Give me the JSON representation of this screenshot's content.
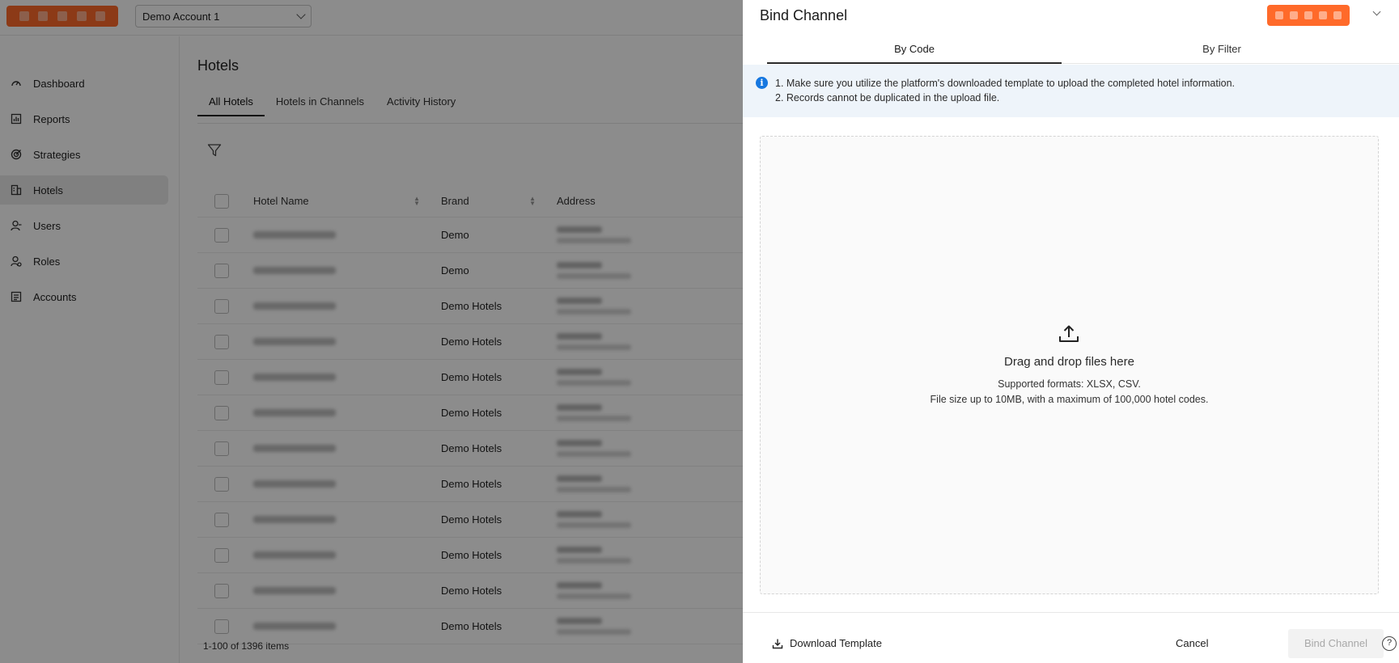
{
  "topbar": {
    "account": "Demo Account 1"
  },
  "sidebar": {
    "items": [
      {
        "label": "Dashboard",
        "icon": "dashboard-icon",
        "active": false
      },
      {
        "label": "Reports",
        "icon": "reports-icon",
        "active": false
      },
      {
        "label": "Strategies",
        "icon": "strategies-icon",
        "active": false
      },
      {
        "label": "Hotels",
        "icon": "hotels-icon",
        "active": true
      },
      {
        "label": "Users",
        "icon": "users-icon",
        "active": false
      },
      {
        "label": "Roles",
        "icon": "roles-icon",
        "active": false
      },
      {
        "label": "Accounts",
        "icon": "accounts-icon",
        "active": false
      }
    ]
  },
  "main": {
    "title": "Hotels",
    "tabs": [
      "All Hotels",
      "Hotels in Channels",
      "Activity History"
    ],
    "table": {
      "headers": [
        "Hotel Name",
        "Brand",
        "Address"
      ],
      "brands": [
        "Demo",
        "Demo",
        "Demo Hotels",
        "Demo Hotels",
        "Demo Hotels",
        "Demo Hotels",
        "Demo Hotels",
        "Demo Hotels",
        "Demo Hotels",
        "Demo Hotels",
        "Demo Hotels",
        "Demo Hotels"
      ]
    },
    "count": "1-100 of 1396 items"
  },
  "drawer": {
    "title": "Bind Channel",
    "tabs": [
      "By Code",
      "By Filter"
    ],
    "notice": {
      "line1": "1. Make sure you utilize the platform's downloaded template to upload the completed hotel information.",
      "line2": "2. Records cannot be duplicated in the upload file."
    },
    "dropzone": {
      "main": "Drag and drop files here",
      "formats": "Supported formats: XLSX, CSV.",
      "limit": "File size up to 10MB, with a maximum of 100,000 hotel codes."
    },
    "footer": {
      "download": "Download Template",
      "cancel": "Cancel",
      "bind": "Bind Channel",
      "help": "?"
    }
  },
  "colors": {
    "accent_logo": "#ff6a2a",
    "info": "#1677e0",
    "notice_bg": "#eef4fa"
  }
}
